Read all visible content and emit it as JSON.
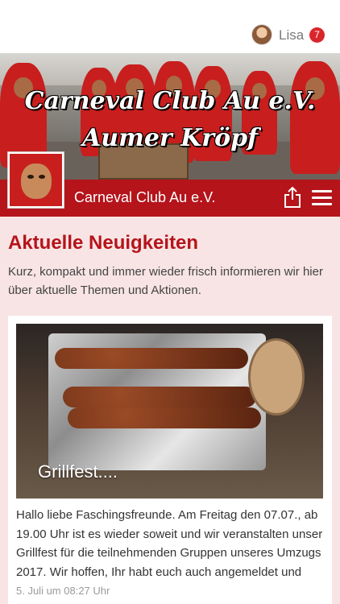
{
  "header": {
    "user_name": "Lisa",
    "notification_count": "7"
  },
  "hero": {
    "title_line1": "Carneval Club Au e.V.",
    "title_line2": "Aumer Kröpf"
  },
  "club_bar": {
    "club_name": "Carneval Club Au e.V.",
    "share_icon": "share-icon",
    "menu_icon": "hamburger-menu-icon"
  },
  "main": {
    "section_title": "Aktuelle Neuigkeiten",
    "intro": "Kurz, kompakt und immer wieder frisch informieren wir hier über aktuelle Themen und Aktionen.",
    "posts": [
      {
        "caption": "Grillfest....",
        "excerpt": "Hallo liebe Faschingsfreunde. Am Freitag den 07.07., ab 19.00 Uhr ist es wieder soweit und wir veranstalten unser Grillfest für die teilnehmenden Gruppen unseres Umzugs 2017. Wir hoffen, Ihr habt euch auch angemeldet und",
        "date": "5. Juli um 08:27 Uhr"
      }
    ]
  },
  "colors": {
    "brand_red": "#b5141b",
    "page_background": "#f8e4e4",
    "badge_red": "#d9262b"
  }
}
